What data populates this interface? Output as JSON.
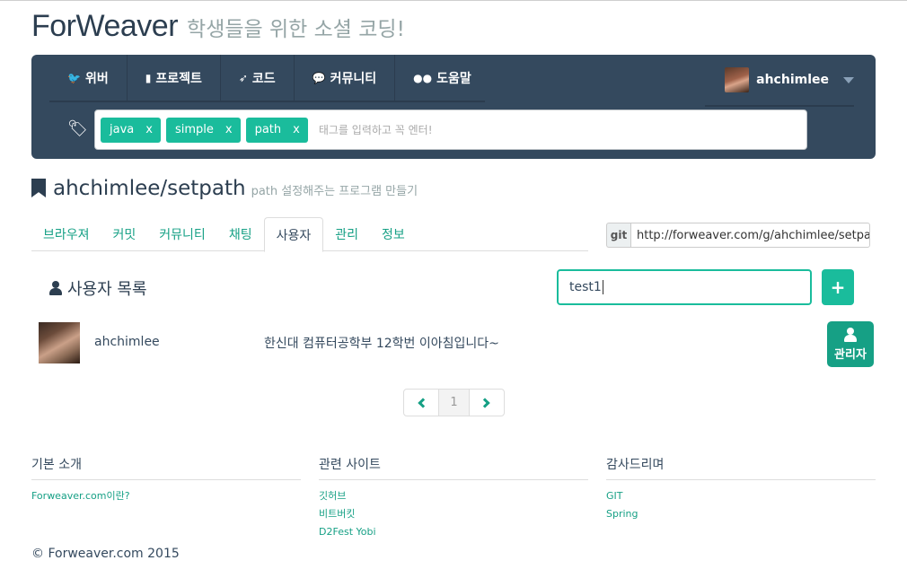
{
  "brand": {
    "name": "ForWeaver",
    "tagline": "학생들을 위한 소셜 코딩!"
  },
  "nav": {
    "items": [
      {
        "icon": "twitter-icon",
        "label": "위버"
      },
      {
        "icon": "bookmark-icon",
        "label": "프로젝트"
      },
      {
        "icon": "rocket-icon",
        "label": "코드"
      },
      {
        "icon": "comments-icon",
        "label": "커뮤니티"
      },
      {
        "icon": "flickr-icon",
        "label": "도움말"
      }
    ],
    "user": {
      "name": "ahchimlee"
    }
  },
  "tags": {
    "items": [
      {
        "label": "java",
        "remove": "x"
      },
      {
        "label": "simple",
        "remove": "x"
      },
      {
        "label": "path",
        "remove": "x"
      }
    ],
    "placeholder": "태그를 입력하고 꼭 엔터!"
  },
  "project": {
    "name": "ahchimlee/setpath",
    "description": "path 설정해주는 프로그램 만들기"
  },
  "tabs": [
    "브라우져",
    "커밋",
    "커뮤니티",
    "채팅",
    "사용자",
    "관리",
    "정보"
  ],
  "active_tab": "사용자",
  "git": {
    "label": "git",
    "url": "http://forweaver.com/g/ahchimlee/setpath.git"
  },
  "users": {
    "title": "사용자 목록",
    "input_value": "test1",
    "add_symbol": "+",
    "rows": [
      {
        "name": "ahchimlee",
        "description": "한신대 컴퓨터공학부 12학번 이아침입니다~",
        "role_button": "관리자"
      }
    ]
  },
  "pagination": {
    "current": "1"
  },
  "footer": {
    "columns": [
      {
        "title": "기본 소개",
        "links": [
          "Forweaver.com이란?"
        ]
      },
      {
        "title": "관련 사이트",
        "links": [
          "깃허브",
          "비트버킷",
          "D2Fest Yobi"
        ]
      },
      {
        "title": "감사드리며",
        "links": [
          "GIT",
          "Spring"
        ]
      }
    ],
    "copyright": "© Forweaver.com 2015"
  },
  "colors": {
    "accent": "#1abc9c",
    "accent_dark": "#16a085",
    "navbar": "#34495e",
    "text": "#2c3e50"
  }
}
